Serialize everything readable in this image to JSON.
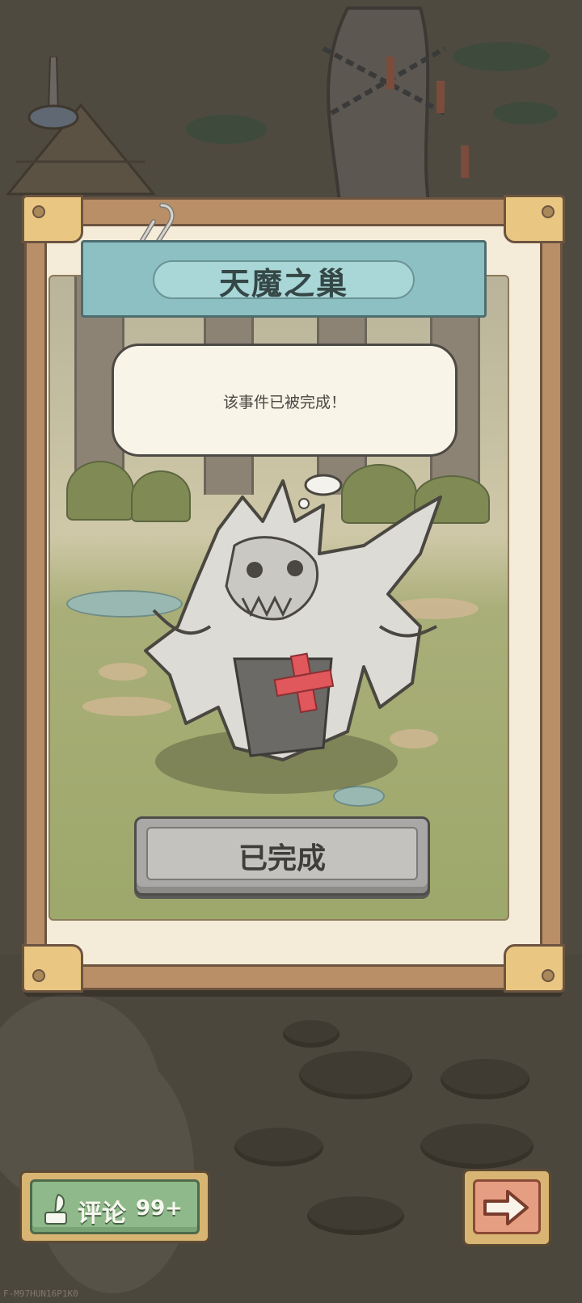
{
  "event": {
    "title": "天魔之巢",
    "message": "该事件已被完成！",
    "status_button_label": "已完成"
  },
  "footer": {
    "comment_label": "评论",
    "comment_count": "99+",
    "next_icon": "arrow-right-icon",
    "comment_icon": "quill-ink-icon"
  },
  "watermark": "F-M97HUN16P1K0",
  "colors": {
    "banner": "#8cc0c2",
    "comment_button": "#8fb98a",
    "next_button": "#e59e81",
    "done_button": "#a9a8a6"
  }
}
